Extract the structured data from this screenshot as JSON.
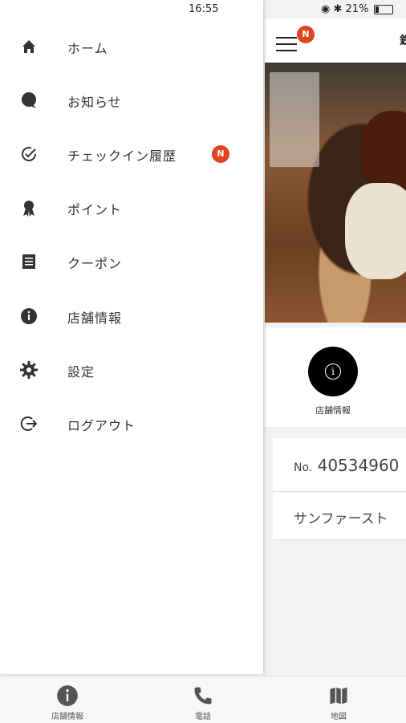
{
  "status_bar": {
    "time": "16:55",
    "battery": "21%",
    "battery_level": 0.21
  },
  "drawer": {
    "items": [
      {
        "label": "ホーム",
        "icon": "home-icon"
      },
      {
        "label": "お知らせ",
        "icon": "chat-bubble-icon"
      },
      {
        "label": "チェックイン履歴",
        "icon": "check-circle-icon",
        "badge": "N"
      },
      {
        "label": "ポイント",
        "icon": "award-ribbon-icon"
      },
      {
        "label": "クーポン",
        "icon": "coupon-list-icon"
      },
      {
        "label": "店舗情報",
        "icon": "info-icon"
      },
      {
        "label": "設定",
        "icon": "gear-icon"
      },
      {
        "label": "ログアウト",
        "icon": "logout-icon"
      }
    ]
  },
  "main": {
    "header": {
      "menu_badge": "N",
      "title_fragment": "鉄"
    },
    "action": {
      "label": "店舗情報",
      "icon": "info-icon"
    },
    "member_card": {
      "no_prefix": "No.",
      "number": "40534960"
    },
    "store_card": {
      "name": "サンファースト"
    }
  },
  "bottom_tabs": [
    {
      "label": "店舗情報",
      "icon": "info-icon"
    },
    {
      "label": "電話",
      "icon": "phone-icon"
    },
    {
      "label": "地図",
      "icon": "map-icon"
    }
  ],
  "colors": {
    "badge": "#e0431f",
    "icon": "#333333"
  }
}
